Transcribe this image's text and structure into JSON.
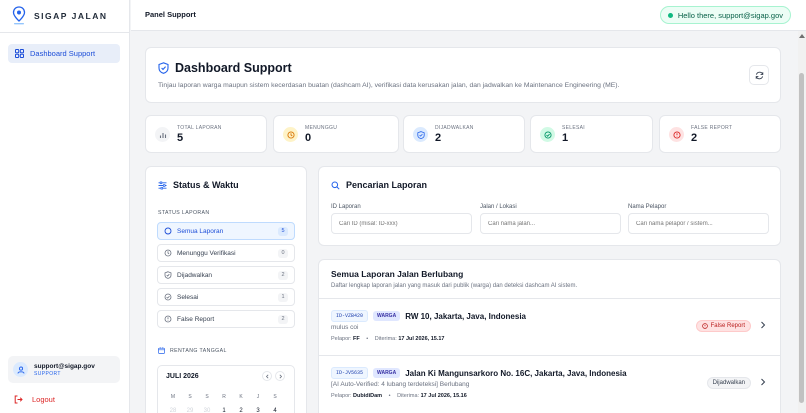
{
  "app": {
    "name": "SIGAP JALAN"
  },
  "sidebar": {
    "items": [
      {
        "label": "Dashboard Support"
      }
    ]
  },
  "user": {
    "email": "support@sigap.gov",
    "role": "SUPPORT"
  },
  "logout_label": "Logout",
  "topbar": {
    "title": "Panel Support",
    "greeting": "Hello there, support@sigap.gov"
  },
  "header": {
    "title": "Dashboard Support",
    "subtitle": "Tinjau laporan warga maupun sistem kecerdasan buatan (dashcam AI), verifikasi data kerusakan jalan, dan jadwalkan ke Maintenance Engineering (ME)."
  },
  "stats": [
    {
      "label": "TOTAL LAPORAN",
      "value": "5",
      "icon": "bar-chart-icon",
      "color": "#6b7280",
      "bg": "#f3f4f6"
    },
    {
      "label": "MENUNGGU",
      "value": "0",
      "icon": "clock-icon",
      "color": "#d97706",
      "bg": "#fef3c7"
    },
    {
      "label": "DIJADWALKAN",
      "value": "2",
      "icon": "shield-check-icon",
      "color": "#2563eb",
      "bg": "#dbeafe"
    },
    {
      "label": "SELESAI",
      "value": "1",
      "icon": "check-circle-icon",
      "color": "#059669",
      "bg": "#d1fae5"
    },
    {
      "label": "FALSE REPORT",
      "value": "2",
      "icon": "alert-circle-icon",
      "color": "#dc2626",
      "bg": "#fee2e2"
    }
  ],
  "filters": {
    "title": "Status & Waktu",
    "status_heading": "STATUS LAPORAN",
    "statuses": [
      {
        "label": "Semua Laporan",
        "count": "5",
        "active": true
      },
      {
        "label": "Menunggu Verifikasi",
        "count": "0"
      },
      {
        "label": "Dijadwalkan",
        "count": "2"
      },
      {
        "label": "Selesai",
        "count": "1"
      },
      {
        "label": "False Report",
        "count": "2"
      }
    ],
    "date_heading": "RENTANG TANGGAL",
    "calendar": {
      "month": "JULI 2026",
      "weekdays": [
        "M",
        "S",
        "S",
        "R",
        "K",
        "J",
        "S"
      ],
      "days": [
        "28",
        "29",
        "30",
        "1",
        "2",
        "3",
        "4"
      ]
    }
  },
  "search": {
    "title": "Pencarian Laporan",
    "fields": [
      {
        "label": "ID Laporan",
        "placeholder": "Cari ID (misal: ID-xxx)"
      },
      {
        "label": "Jalan / Lokasi",
        "placeholder": "Cari nama jalan..."
      },
      {
        "label": "Nama Pelapor",
        "placeholder": "Cari nama pelapor / sistem..."
      }
    ]
  },
  "reports": {
    "title": "Semua Laporan Jalan Berlubang",
    "subtitle": "Daftar lengkap laporan jalan yang masuk dari publik (warga) dan deteksi dashcam AI sistem.",
    "reporter_label": "Pelapor:",
    "received_label": "Diterima:",
    "items": [
      {
        "id": "ID-VZB420",
        "source": "WARGA",
        "location": "RW 10, Jakarta, Java, Indonesia",
        "description": "mulus coi",
        "reporter": "FF",
        "received": "17 Jul 2026, 15.17",
        "status": "False Report"
      },
      {
        "id": "ID-JV5635",
        "source": "WARGA",
        "location": "Jalan Ki Mangunsarkoro No. 16C, Jakarta, Java, Indonesia",
        "description": "[AI Auto-Verified: 4 lubang terdeteksi] Berlubang",
        "reporter": "DubidiDam",
        "received": "17 Jul 2026, 15.16",
        "status": "Dijadwalkan"
      }
    ]
  }
}
